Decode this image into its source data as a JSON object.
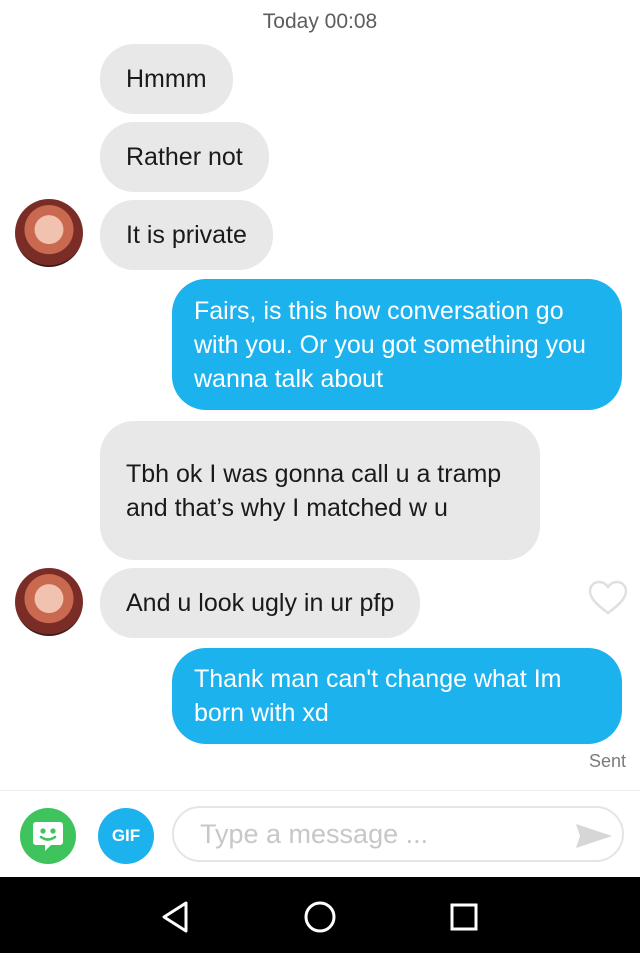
{
  "chat": {
    "timestamp": "Today 00:08",
    "messages": [
      {
        "from": "them",
        "text": "Hmmm"
      },
      {
        "from": "them",
        "text": "Rather not"
      },
      {
        "from": "them",
        "text": "It is private"
      },
      {
        "from": "me",
        "text": "Fairs, is this how conversation go with you. Or you got something you wanna talk about"
      },
      {
        "from": "them",
        "text": "Tbh ok I was gonna call u a tramp and that’s why I matched w u"
      },
      {
        "from": "them",
        "text": "And u look ugly in ur pfp"
      },
      {
        "from": "me",
        "text": "Thank man can't change what Im born with xd"
      }
    ],
    "status": "Sent"
  },
  "composer": {
    "gif_label": "GIF",
    "placeholder": "Type a message ..."
  },
  "colors": {
    "incoming_bubble": "#e8e8e8",
    "outgoing_bubble": "#1cb2ee",
    "bitmoji_green": "#3ec35d",
    "nav_bar": "#000000"
  },
  "icons": [
    "bitmoji-icon",
    "send-icon",
    "heart-icon",
    "nav-back-icon",
    "nav-home-icon",
    "nav-recents-icon"
  ]
}
